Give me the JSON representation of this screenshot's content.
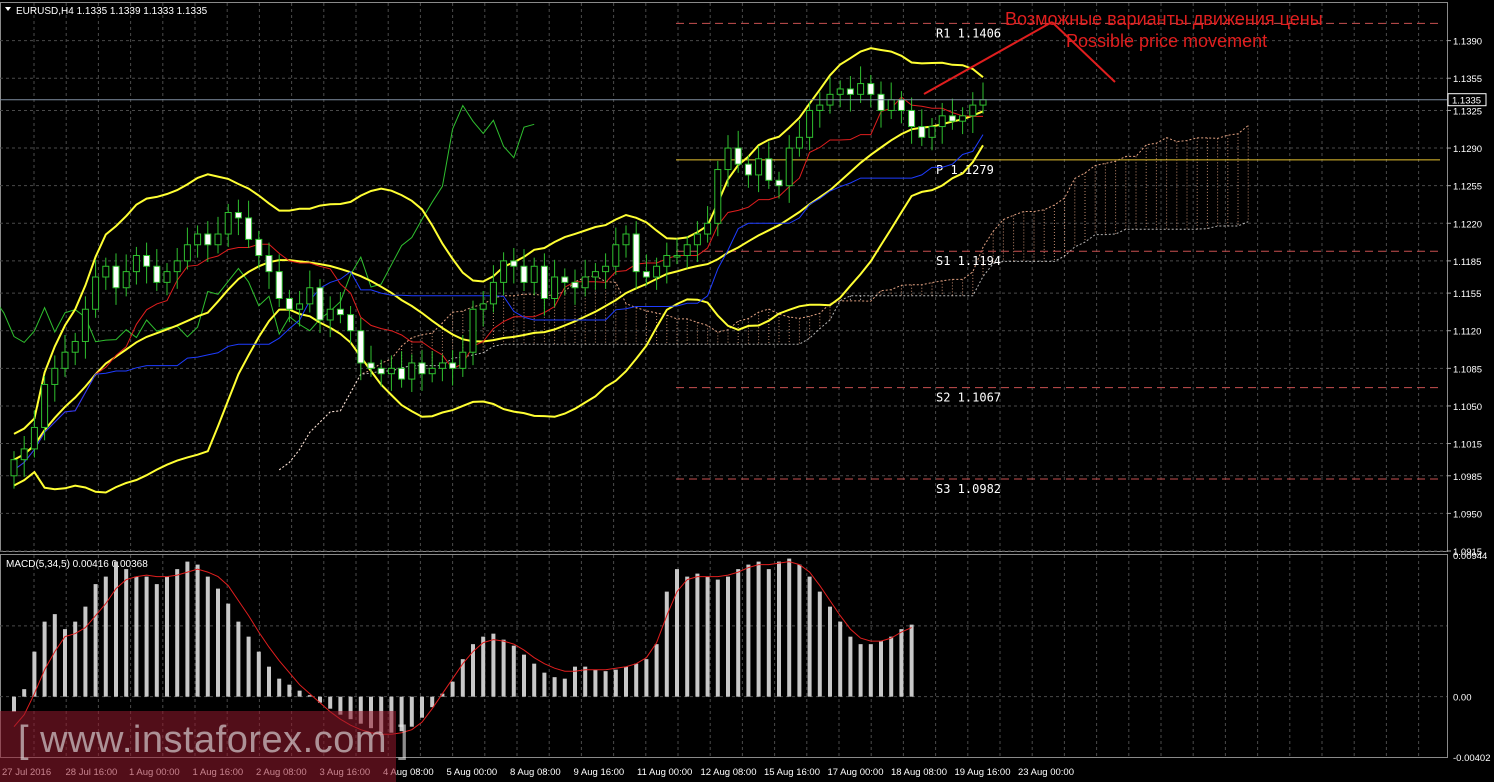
{
  "header": {
    "symbol_label": "EURUSD,H4",
    "ohlc": "1.1335 1.1339 1.1333 1.1335"
  },
  "annotation": {
    "ru": "Возможные варианты движения цены",
    "en": "Possible price movement",
    "color": "#e01e1e"
  },
  "macd_label": "MACD(5,34,5) 0.00416 0.00368",
  "current_price_label": "1.1335",
  "watermark": "[ www.instaforex.com ]",
  "colors": {
    "background": "#000000",
    "grid": "#4a4a4a",
    "bollinger": "#ffff33",
    "tenkan": "#e01e1e",
    "kijun": "#1e3cff",
    "chikou": "#2fbf2f",
    "candle_bull": "#000000",
    "candle_bear": "#ffffff",
    "candle_wick": "#2fbf2f",
    "macd_hist": "#c8c8c8",
    "macd_signal": "#e01e1e",
    "pivot": "#e6c232",
    "level": "#c85050",
    "cloud_a": "#e0a080",
    "cloud_b": "#ffffff"
  },
  "chart_data": [
    {
      "type": "candlestick",
      "symbol": "EURUSD",
      "timeframe": "H4",
      "ylim": [
        1.0915,
        1.1425
      ],
      "y_ticks": [
        "1.1390",
        "1.1355",
        "1.1325",
        "1.1290",
        "1.1255",
        "1.1220",
        "1.1185",
        "1.1155",
        "1.1120",
        "1.1085",
        "1.1050",
        "1.1015",
        "1.0985",
        "1.0950",
        "1.0915"
      ],
      "x_ticks": [
        "27 Jul 2016",
        "28 Jul 16:00",
        "1 Aug 00:00",
        "1 Aug 16:00",
        "2 Aug 08:00",
        "3 Aug 16:00",
        "4 Aug 08:00",
        "5 Aug 00:00",
        "8 Aug 08:00",
        "9 Aug 16:00",
        "11 Aug 00:00",
        "12 Aug 08:00",
        "15 Aug 16:00",
        "17 Aug 00:00",
        "18 Aug 08:00",
        "19 Aug 16:00",
        "23 Aug 00:00"
      ],
      "current_price": 1.1335,
      "levels": [
        {
          "label": "R1 1.1406",
          "value": 1.1406
        },
        {
          "label": "P 1.1279",
          "value": 1.1279
        },
        {
          "label": "S1 1.1194",
          "value": 1.1194
        },
        {
          "label": "S2 1.1067",
          "value": 1.1067
        },
        {
          "label": "S3 1.0982",
          "value": 1.0982
        }
      ],
      "close": [
        1.1,
        1.101,
        1.103,
        1.107,
        1.1085,
        1.11,
        1.111,
        1.114,
        1.117,
        1.118,
        1.116,
        1.1175,
        1.119,
        1.118,
        1.1165,
        1.1175,
        1.1185,
        1.12,
        1.121,
        1.12,
        1.121,
        1.123,
        1.1225,
        1.1205,
        1.119,
        1.1175,
        1.115,
        1.114,
        1.1145,
        1.116,
        1.113,
        1.114,
        1.1135,
        1.112,
        1.109,
        1.1085,
        1.108,
        1.1085,
        1.1075,
        1.109,
        1.108,
        1.1085,
        1.109,
        1.1085,
        1.11,
        1.114,
        1.1145,
        1.1165,
        1.1185,
        1.118,
        1.1165,
        1.118,
        1.115,
        1.117,
        1.1165,
        1.116,
        1.117,
        1.1175,
        1.118,
        1.12,
        1.121,
        1.1175,
        1.117,
        1.118,
        1.119,
        1.119,
        1.12,
        1.121,
        1.122,
        1.127,
        1.129,
        1.1275,
        1.1265,
        1.128,
        1.126,
        1.1255,
        1.129,
        1.13,
        1.1325,
        1.133,
        1.134,
        1.1345,
        1.134,
        1.135,
        1.134,
        1.1325,
        1.1335,
        1.1325,
        1.131,
        1.13,
        1.131,
        1.132,
        1.1315,
        1.132,
        1.133,
        1.1335
      ]
    },
    {
      "type": "macd_histogram",
      "name": "MACD(5,34,5)",
      "ylim": [
        -0.00402,
        0.00944
      ],
      "y_ticks": [
        "0.00944",
        "0.00",
        "-0.00402"
      ],
      "values": [
        -0.001,
        0.0005,
        0.003,
        0.005,
        0.0055,
        0.0045,
        0.005,
        0.006,
        0.0075,
        0.008,
        0.009,
        0.0085,
        0.008,
        0.008,
        0.0075,
        0.008,
        0.0085,
        0.009,
        0.0088,
        0.008,
        0.0072,
        0.0062,
        0.005,
        0.004,
        0.003,
        0.002,
        0.0012,
        0.0008,
        0.0004,
        0.0001,
        -0.0004,
        -0.0008,
        -0.0012,
        -0.0015,
        -0.0018,
        -0.0021,
        -0.0024,
        -0.0024,
        -0.0023,
        -0.002,
        -0.0014,
        -0.0007,
        0.0002,
        0.001,
        0.0025,
        0.0035,
        0.004,
        0.0042,
        0.0038,
        0.0034,
        0.0028,
        0.0022,
        0.0016,
        0.0013,
        0.0012,
        0.002,
        0.002,
        0.0018,
        0.0017,
        0.0018,
        0.002,
        0.0022,
        0.0025,
        0.0035,
        0.007,
        0.0085,
        0.008,
        0.0082,
        0.008,
        0.0078,
        0.008,
        0.0085,
        0.0088,
        0.009,
        0.0085,
        0.009,
        0.0092,
        0.0088,
        0.008,
        0.007,
        0.006,
        0.005,
        0.004,
        0.0035,
        0.0035,
        0.0037,
        0.004,
        0.0045,
        0.0048
      ],
      "signal": [
        -0.002,
        -0.0012,
        0.0002,
        0.0018,
        0.003,
        0.004,
        0.0042,
        0.0046,
        0.0054,
        0.0062,
        0.0072,
        0.0078,
        0.008,
        0.0081,
        0.008,
        0.008,
        0.0081,
        0.0083,
        0.0085,
        0.0083,
        0.008,
        0.0074,
        0.0064,
        0.0054,
        0.0043,
        0.0033,
        0.0024,
        0.0016,
        0.0008,
        0.0002,
        -0.0004,
        -0.001,
        -0.0015,
        -0.0019,
        -0.0022,
        -0.0024,
        -0.0025,
        -0.0025,
        -0.0024,
        -0.0022,
        -0.0017,
        -0.0008,
        0.0002,
        0.0012,
        0.0022,
        0.003,
        0.0036,
        0.0038,
        0.0037,
        0.0035,
        0.0031,
        0.0026,
        0.0022,
        0.0019,
        0.0017,
        0.0017,
        0.0018,
        0.0018,
        0.0018,
        0.0019,
        0.002,
        0.0022,
        0.0026,
        0.0036,
        0.0054,
        0.007,
        0.0078,
        0.008,
        0.008,
        0.008,
        0.0081,
        0.0083,
        0.0086,
        0.0088,
        0.0088,
        0.0089,
        0.009,
        0.0088,
        0.0083,
        0.0074,
        0.0064,
        0.0054,
        0.0045,
        0.0039,
        0.0037,
        0.0037,
        0.0039,
        0.0043,
        0.0046
      ]
    }
  ]
}
